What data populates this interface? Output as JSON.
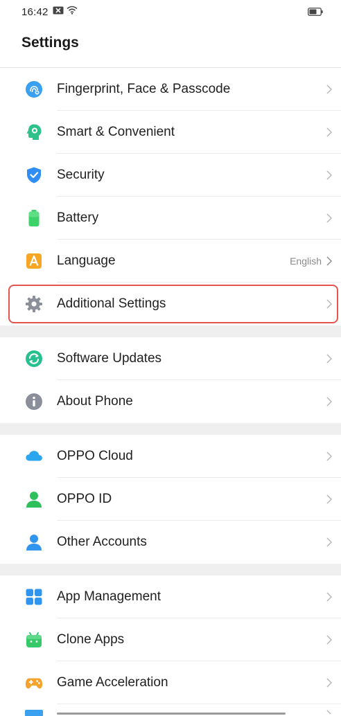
{
  "status_bar": {
    "time": "16:42"
  },
  "header": {
    "title": "Settings"
  },
  "groups": [
    {
      "items": [
        {
          "label": "Fingerprint, Face & Passcode",
          "icon": "fingerprint-face-icon",
          "color": "#3aa0ef"
        },
        {
          "label": "Smart & Convenient",
          "icon": "smart-convenient-icon",
          "color": "#2ec28a"
        },
        {
          "label": "Security",
          "icon": "shield-icon",
          "color": "#2f8ef5"
        },
        {
          "label": "Battery",
          "icon": "battery-icon",
          "color": "#3ed26a"
        },
        {
          "label": "Language",
          "icon": "language-icon",
          "color": "#f6a623",
          "value": "English"
        },
        {
          "label": "Additional Settings",
          "icon": "gear-icon",
          "color": "#8a8f99",
          "highlighted": true
        }
      ]
    },
    {
      "items": [
        {
          "label": "Software Updates",
          "icon": "software-update-icon",
          "color": "#27c08f"
        },
        {
          "label": "About Phone",
          "icon": "info-icon",
          "color": "#8a8f99"
        }
      ]
    },
    {
      "items": [
        {
          "label": "OPPO Cloud",
          "icon": "cloud-icon",
          "color": "#2aa6ee"
        },
        {
          "label": "OPPO ID",
          "icon": "user-id-icon",
          "color": "#2fbf5b"
        },
        {
          "label": "Other Accounts",
          "icon": "user-accounts-icon",
          "color": "#2f95ee"
        }
      ]
    },
    {
      "items": [
        {
          "label": "App Management",
          "icon": "app-grid-icon",
          "color": "#2f95ee"
        },
        {
          "label": "Clone Apps",
          "icon": "clone-apps-icon",
          "color": "#36c96a"
        },
        {
          "label": "Game Acceleration",
          "icon": "gamepad-icon",
          "color": "#f4a32c"
        }
      ]
    }
  ]
}
